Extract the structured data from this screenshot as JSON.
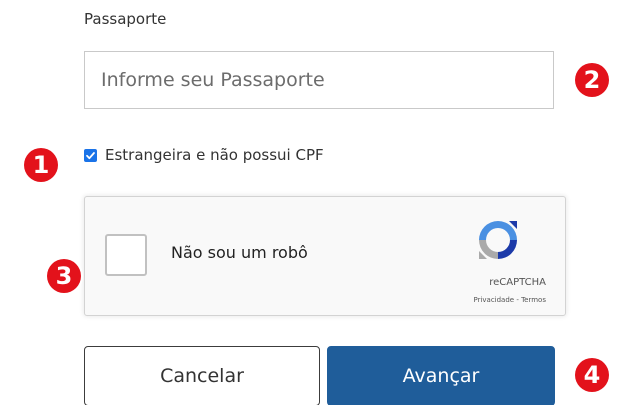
{
  "form": {
    "passport_label": "Passaporte",
    "passport_placeholder": "Informe seu Passaporte",
    "passport_value": "",
    "foreigner_checkbox_label": "Estrangeira e não possui CPF",
    "foreigner_checked": true
  },
  "recaptcha": {
    "label": "Não sou um robô",
    "brand": "reCAPTCHA",
    "privacy": "Privacidade",
    "separator": " - ",
    "terms": "Termos",
    "checked": false
  },
  "buttons": {
    "cancel_label": "Cancelar",
    "next_label": "Avançar"
  },
  "markers": {
    "m1": "1",
    "m2": "2",
    "m3": "3",
    "m4": "4"
  },
  "colors": {
    "marker": "#e3121b",
    "primary_button": "#1f5d9a",
    "checkbox": "#1a73e8"
  }
}
